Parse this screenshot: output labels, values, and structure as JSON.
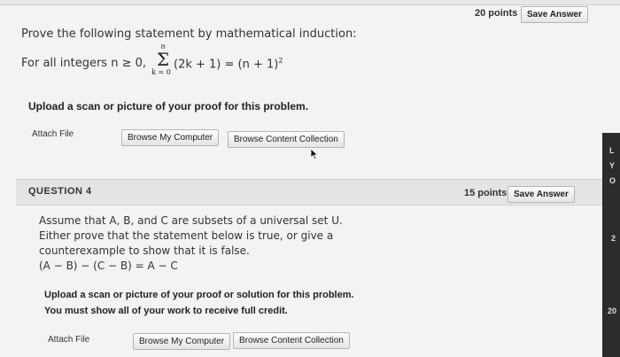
{
  "q3": {
    "points": "20 points",
    "save_label": "Save Answer",
    "statement": "Prove the following statement by mathematical induction:",
    "for_all": "For all integers n ≥ 0,",
    "sum_upper": "n",
    "sum_lower": "k = 0",
    "sum_symbol": "Σ",
    "sum_expr": "(2k + 1) = (n + 1)",
    "sum_exp": "2",
    "upload": "Upload a scan or picture of your proof for this problem.",
    "attach_label": "Attach File",
    "browse_computer": "Browse My Computer",
    "browse_content": "Browse Content Collection"
  },
  "q4": {
    "title": "QUESTION 4",
    "points": "15 points",
    "save_label": "Save Answer",
    "lines": [
      "Assume that A, B, and C are subsets of a universal set U.",
      "Either prove that the statement below is true, or give a",
      "counterexample to show that it is false.",
      "(A − B) − (C − B) = A − C"
    ],
    "upload_line1": "Upload a scan or picture of your proof or solution for this problem.",
    "upload_line2": "You must show all of your work to receive full credit.",
    "attach_label": "Attach File",
    "browse_computer": "Browse My Computer",
    "browse_content": "Browse Content Collection"
  },
  "edge": {
    "letters": [
      "L",
      "Y",
      "O"
    ],
    "num": "2",
    "num2": "20"
  }
}
